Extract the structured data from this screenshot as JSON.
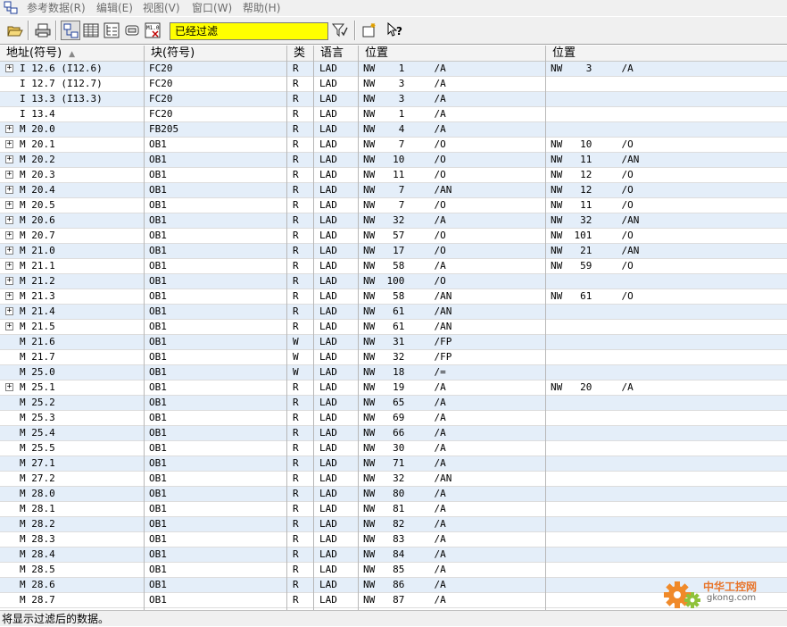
{
  "menubar": {
    "items": [
      "参考数据(R)",
      "编辑(E)",
      "视图(V)",
      "窗口(W)",
      "帮助(H)"
    ]
  },
  "toolbar": {
    "buttons": [
      "open-icon",
      "print-icon",
      "cross-reference-icon",
      "list-view-icon",
      "tree-view-icon",
      "overview-icon",
      "assignment-icon",
      "filter-icon",
      "new-window-icon",
      "help-icon"
    ],
    "filter_text": "已经过滤"
  },
  "table": {
    "headers": [
      "地址(符号)",
      "块(符号)",
      "类",
      "语言",
      "位置",
      "位置"
    ],
    "sort_indicator": "▲",
    "rows": [
      {
        "expand": true,
        "addr": "I 12.6 (I12.6)",
        "block": "FC20",
        "type": "R",
        "lang": "LAD",
        "pos1": "NW    1     /A",
        "pos2": "NW    3     /A"
      },
      {
        "expand": false,
        "addr": "I 12.7 (I12.7)",
        "block": "FC20",
        "type": "R",
        "lang": "LAD",
        "pos1": "NW    3     /A",
        "pos2": ""
      },
      {
        "expand": false,
        "addr": "I 13.3 (I13.3)",
        "block": "FC20",
        "type": "R",
        "lang": "LAD",
        "pos1": "NW    3     /A",
        "pos2": ""
      },
      {
        "expand": false,
        "addr": "I 13.4",
        "block": "FC20",
        "type": "R",
        "lang": "LAD",
        "pos1": "NW    1     /A",
        "pos2": ""
      },
      {
        "expand": true,
        "addr": "M 20.0",
        "block": "FB205",
        "type": "R",
        "lang": "LAD",
        "pos1": "NW    4     /A",
        "pos2": ""
      },
      {
        "expand": true,
        "addr": "M 20.1",
        "block": "OB1",
        "type": "R",
        "lang": "LAD",
        "pos1": "NW    7     /O",
        "pos2": "NW   10     /O"
      },
      {
        "expand": true,
        "addr": "M 20.2",
        "block": "OB1",
        "type": "R",
        "lang": "LAD",
        "pos1": "NW   10     /O",
        "pos2": "NW   11     /AN"
      },
      {
        "expand": true,
        "addr": "M 20.3",
        "block": "OB1",
        "type": "R",
        "lang": "LAD",
        "pos1": "NW   11     /O",
        "pos2": "NW   12     /O"
      },
      {
        "expand": true,
        "addr": "M 20.4",
        "block": "OB1",
        "type": "R",
        "lang": "LAD",
        "pos1": "NW    7     /AN",
        "pos2": "NW   12     /O"
      },
      {
        "expand": true,
        "addr": "M 20.5",
        "block": "OB1",
        "type": "R",
        "lang": "LAD",
        "pos1": "NW    7     /O",
        "pos2": "NW   11     /O"
      },
      {
        "expand": true,
        "addr": "M 20.6",
        "block": "OB1",
        "type": "R",
        "lang": "LAD",
        "pos1": "NW   32     /A",
        "pos2": "NW   32     /AN"
      },
      {
        "expand": true,
        "addr": "M 20.7",
        "block": "OB1",
        "type": "R",
        "lang": "LAD",
        "pos1": "NW   57     /O",
        "pos2": "NW  101     /O"
      },
      {
        "expand": true,
        "addr": "M 21.0",
        "block": "OB1",
        "type": "R",
        "lang": "LAD",
        "pos1": "NW   17     /O",
        "pos2": "NW   21     /AN"
      },
      {
        "expand": true,
        "addr": "M 21.1",
        "block": "OB1",
        "type": "R",
        "lang": "LAD",
        "pos1": "NW   58     /A",
        "pos2": "NW   59     /O"
      },
      {
        "expand": true,
        "addr": "M 21.2",
        "block": "OB1",
        "type": "R",
        "lang": "LAD",
        "pos1": "NW  100     /O",
        "pos2": ""
      },
      {
        "expand": true,
        "addr": "M 21.3",
        "block": "OB1",
        "type": "R",
        "lang": "LAD",
        "pos1": "NW   58     /AN",
        "pos2": "NW   61     /O"
      },
      {
        "expand": true,
        "addr": "M 21.4",
        "block": "OB1",
        "type": "R",
        "lang": "LAD",
        "pos1": "NW   61     /AN",
        "pos2": ""
      },
      {
        "expand": true,
        "addr": "M 21.5",
        "block": "OB1",
        "type": "R",
        "lang": "LAD",
        "pos1": "NW   61     /AN",
        "pos2": ""
      },
      {
        "expand": false,
        "addr": "M 21.6",
        "block": "OB1",
        "type": "W",
        "lang": "LAD",
        "pos1": "NW   31     /FP",
        "pos2": ""
      },
      {
        "expand": false,
        "addr": "M 21.7",
        "block": "OB1",
        "type": "W",
        "lang": "LAD",
        "pos1": "NW   32     /FP",
        "pos2": ""
      },
      {
        "expand": false,
        "addr": "M 25.0",
        "block": "OB1",
        "type": "W",
        "lang": "LAD",
        "pos1": "NW   18     /=",
        "pos2": ""
      },
      {
        "expand": true,
        "addr": "M 25.1",
        "block": "OB1",
        "type": "R",
        "lang": "LAD",
        "pos1": "NW   19     /A",
        "pos2": "NW   20     /A"
      },
      {
        "expand": false,
        "addr": "M 25.2",
        "block": "OB1",
        "type": "R",
        "lang": "LAD",
        "pos1": "NW   65     /A",
        "pos2": ""
      },
      {
        "expand": false,
        "addr": "M 25.3",
        "block": "OB1",
        "type": "R",
        "lang": "LAD",
        "pos1": "NW   69     /A",
        "pos2": ""
      },
      {
        "expand": false,
        "addr": "M 25.4",
        "block": "OB1",
        "type": "R",
        "lang": "LAD",
        "pos1": "NW   66     /A",
        "pos2": ""
      },
      {
        "expand": false,
        "addr": "M 25.5",
        "block": "OB1",
        "type": "R",
        "lang": "LAD",
        "pos1": "NW   30     /A",
        "pos2": ""
      },
      {
        "expand": false,
        "addr": "M 27.1",
        "block": "OB1",
        "type": "R",
        "lang": "LAD",
        "pos1": "NW   71     /A",
        "pos2": ""
      },
      {
        "expand": false,
        "addr": "M 27.2",
        "block": "OB1",
        "type": "R",
        "lang": "LAD",
        "pos1": "NW   32     /AN",
        "pos2": ""
      },
      {
        "expand": false,
        "addr": "M 28.0",
        "block": "OB1",
        "type": "R",
        "lang": "LAD",
        "pos1": "NW   80     /A",
        "pos2": ""
      },
      {
        "expand": false,
        "addr": "M 28.1",
        "block": "OB1",
        "type": "R",
        "lang": "LAD",
        "pos1": "NW   81     /A",
        "pos2": ""
      },
      {
        "expand": false,
        "addr": "M 28.2",
        "block": "OB1",
        "type": "R",
        "lang": "LAD",
        "pos1": "NW   82     /A",
        "pos2": ""
      },
      {
        "expand": false,
        "addr": "M 28.3",
        "block": "OB1",
        "type": "R",
        "lang": "LAD",
        "pos1": "NW   83     /A",
        "pos2": ""
      },
      {
        "expand": false,
        "addr": "M 28.4",
        "block": "OB1",
        "type": "R",
        "lang": "LAD",
        "pos1": "NW   84     /A",
        "pos2": ""
      },
      {
        "expand": false,
        "addr": "M 28.5",
        "block": "OB1",
        "type": "R",
        "lang": "LAD",
        "pos1": "NW   85     /A",
        "pos2": ""
      },
      {
        "expand": false,
        "addr": "M 28.6",
        "block": "OB1",
        "type": "R",
        "lang": "LAD",
        "pos1": "NW   86     /A",
        "pos2": ""
      },
      {
        "expand": false,
        "addr": "M 28.7",
        "block": "OB1",
        "type": "R",
        "lang": "LAD",
        "pos1": "NW   87     /A",
        "pos2": ""
      }
    ]
  },
  "statusbar": {
    "text": "将显示过滤后的数据。"
  },
  "watermark": {
    "logo": "gear-logo-icon",
    "title": "中华工控网",
    "site": "gkong.com"
  },
  "colors": {
    "filter_bg": "#ffff00",
    "alt_row": "#e4eef9"
  }
}
